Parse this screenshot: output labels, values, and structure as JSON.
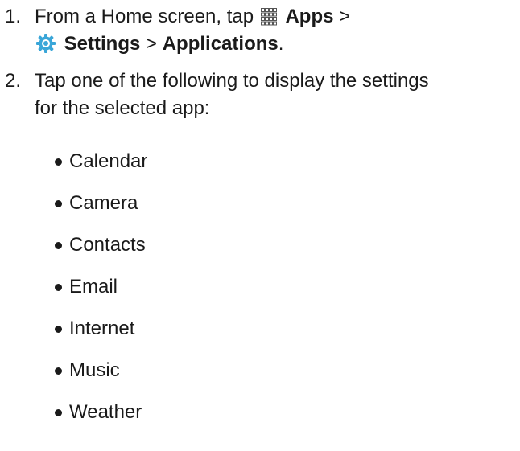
{
  "steps": [
    {
      "number": "1.",
      "line1": {
        "text_before": "From a Home screen, tap",
        "apps_icon": "apps-grid-icon",
        "apps_label": "Apps",
        "separator1": ">"
      },
      "line2": {
        "settings_icon": "settings-gear-icon",
        "settings_label": "Settings",
        "separator2": ">",
        "applications_label": "Applications",
        "period": "."
      }
    },
    {
      "number": "2.",
      "line1": "Tap one of the following to display the settings",
      "line2": "for the selected app:"
    }
  ],
  "apps": [
    "Calendar",
    "Camera",
    "Contacts",
    "Email",
    "Internet",
    "Music",
    "Weather"
  ],
  "colors": {
    "text": "#1a1a1a",
    "settings_icon": "#3aa6d8"
  }
}
